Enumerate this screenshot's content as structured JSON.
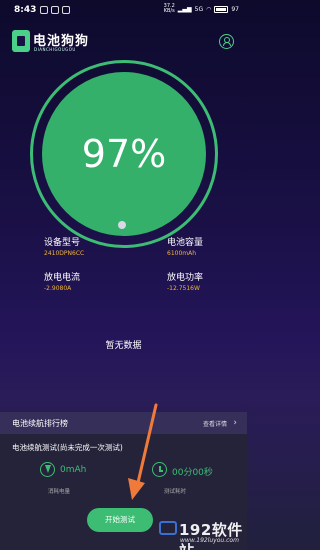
{
  "status_bar": {
    "time": "8:43",
    "net_speed": "37.2",
    "net_unit": "KB/s",
    "signal_label": "5G",
    "battery_level": "97"
  },
  "header": {
    "app_name": "电池狗狗",
    "app_sub": "DIANCHIGOUGOU"
  },
  "gauge": {
    "percent": 0.97,
    "label": "97%"
  },
  "info": {
    "model_label": "设备型号",
    "model_value": "2410DPN6CC",
    "capacity_label": "电池容量",
    "capacity_value": "6100mAh",
    "current_label": "放电电流",
    "current_value": "-2.9080A",
    "power_label": "放电功率",
    "power_value": "-12.7516W"
  },
  "empty_text": "暂无数据",
  "ranking": {
    "title": "电池续航排行榜",
    "detail": "查看详情"
  },
  "test": {
    "title": "电池续航测试(尚未完成一次测试)",
    "consumed_value": "0mAh",
    "consumed_label": "消耗电量",
    "time_value": "00分00秒",
    "time_label": "测试耗时",
    "start_button": "开始测试"
  },
  "watermark": {
    "brand": "192软件站",
    "url": "www.192luyou.com"
  },
  "colors": {
    "accent": "#3dbd74",
    "orange": "#f0b43a",
    "arrow": "#f07a3a"
  }
}
